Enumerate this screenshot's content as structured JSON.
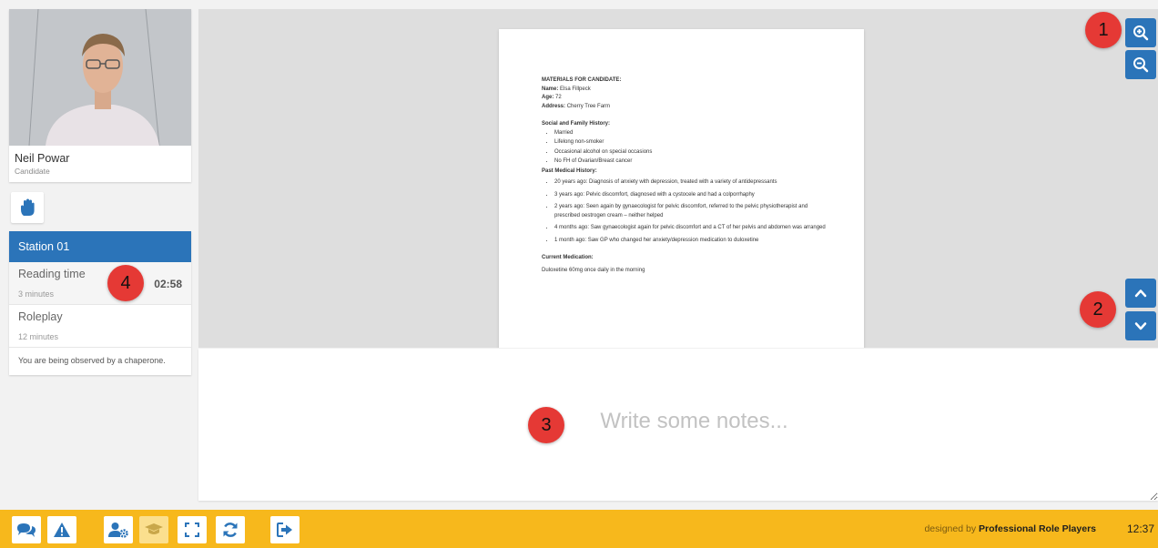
{
  "candidate": {
    "name": "Neil Powar",
    "role": "Candidate"
  },
  "hand_button_icon": "hand-icon",
  "station": {
    "title": "Station 01",
    "phases": [
      {
        "label": "Reading time",
        "duration": "3 minutes",
        "timer": "02:58"
      },
      {
        "label": "Roleplay",
        "duration": "12 minutes"
      }
    ],
    "observed_notice": "You are being observed by a chaperone."
  },
  "document": {
    "heading": "MATERIALS FOR CANDIDATE:",
    "fields": [
      {
        "label": "Name:",
        "value": "Elsa Fillpeck"
      },
      {
        "label": "Age:",
        "value": "72"
      },
      {
        "label": "Address:",
        "value": "Cherry Tree Farm"
      }
    ],
    "social_heading": "Social and Family History:",
    "social_items": [
      "Married",
      "Lifelong non-smoker",
      "Occasional alcohol on special occasions",
      "No FH of Ovarian/Breast cancer"
    ],
    "pmh_heading": "Past Medical History:",
    "pmh_items": [
      "20 years ago: Diagnosis of anxiety with depression, treated with a variety of antidepressants",
      "3 years ago: Pelvic discomfort, diagnosed with a cystocele and had a colporrhaphy",
      "2 years ago: Seen again by gynaecologist for pelvic discomfort, referred to the pelvic physiotherapist and prescribed oestrogen cream – neither helped",
      "4 months ago: Saw gynaecologist again for pelvic discomfort and a CT of her pelvis and abdomen was arranged",
      "1 month ago: Saw GP who changed her anxiety/depression medication to duloxetine"
    ],
    "med_heading": "Current Medication:",
    "med_text": "Duloxetine 60mg once daily in the morning"
  },
  "viewer_controls": {
    "zoom_in_icon": "zoom-in-icon",
    "zoom_out_icon": "zoom-out-icon",
    "scroll_up_icon": "chevron-up-icon",
    "scroll_down_icon": "chevron-down-icon"
  },
  "notes": {
    "placeholder": "Write some notes...",
    "value": ""
  },
  "markers": [
    "1",
    "2",
    "3",
    "4"
  ],
  "toolbar": {
    "icons": [
      "chat-icon",
      "warning-icon",
      "user-settings-icon",
      "graduation-cap-icon",
      "fullscreen-icon",
      "refresh-icon",
      "logout-icon"
    ],
    "credit_prefix": "designed by",
    "credit_brand": "Professional Role Players",
    "clock": "12:37"
  },
  "colors": {
    "accent_blue": "#2b74b9",
    "toolbar_yellow": "#f7b81c",
    "marker_red": "#e53935"
  }
}
